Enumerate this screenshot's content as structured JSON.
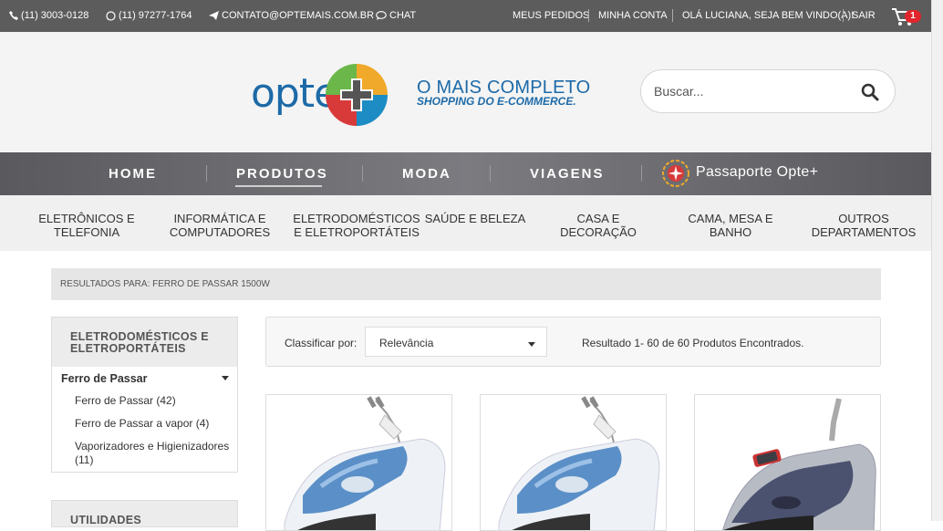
{
  "topbar": {
    "phone": "(11) 3003-0128",
    "whatsapp": "(11) 97277-1764",
    "email": "CONTATO@OPTEMAIS.COM.BR",
    "chat": "CHAT",
    "orders": "MEUS PEDIDOS",
    "account": "MINHA CONTA",
    "greeting": "OLÁ LUCIANA, SEJA BEM VINDO(A)!",
    "logout": "SAIR",
    "cart_count": "1"
  },
  "header": {
    "logo_text": "opte.",
    "slogan_line1": "O MAIS COMPLETO",
    "slogan_line2": "SHOPPING DO E-COMMERCE.",
    "search_placeholder": "Buscar..."
  },
  "main_nav": {
    "items": [
      "HOME",
      "PRODUTOS",
      "MODA",
      "VIAGENS"
    ],
    "active": "PRODUTOS",
    "passaporte": "Passaporte Opte+"
  },
  "categories": [
    [
      "ELETRÔNICOS E",
      "TELEFONIA"
    ],
    [
      "INFORMÁTICA E",
      "COMPUTADORES"
    ],
    [
      "ELETRODOMÉSTICOS",
      "E ELETROPORTÁTEIS"
    ],
    [
      "SAÚDE E BELEZA"
    ],
    [
      "CASA E",
      "DECORAÇÃO"
    ],
    [
      "CAMA, MESA E",
      "BANHO"
    ],
    [
      "OUTROS",
      "DEPARTAMENTOS"
    ]
  ],
  "breadcrumb": "RESULTADOS PARA: FERRO DE PASSAR 1500W",
  "sidebar": {
    "box_title_line1": "ELETRODOMÉSTICOS E",
    "box_title_line2": "ELETROPORTÁTEIS",
    "subcategory": "Ferro de Passar",
    "items": [
      "Ferro de Passar (42)",
      "Ferro de Passar a vapor (4)",
      "Vaporizadores e Higienizadores (11)"
    ],
    "box2_title": "UTILIDADES"
  },
  "sort": {
    "label": "Classificar por:",
    "selected": "Relevância",
    "results": "Resultado 1- 60 de 60 Produtos Encontrados."
  },
  "colors": {
    "brand_blue": "#1d6aa8",
    "topbar_bg": "#5c5c5c",
    "badge_red": "#e0262c"
  }
}
